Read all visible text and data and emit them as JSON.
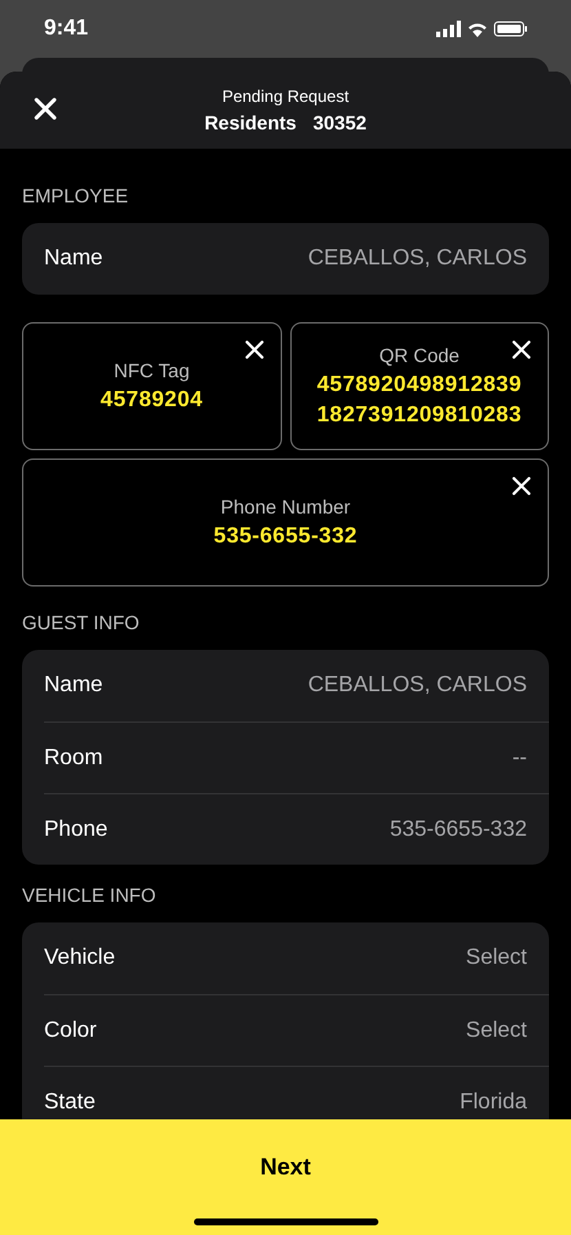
{
  "status_bar": {
    "time": "9:41"
  },
  "header": {
    "subtitle": "Pending Request",
    "title": "Residents",
    "number": "30352"
  },
  "sections": [
    {
      "title": "EMPLOYEE",
      "rows": [
        {
          "label": "Name",
          "value": "CEBALLOS, CARLOS"
        }
      ]
    },
    {
      "kind": "credentials",
      "tiles": [
        {
          "label": "NFC Tag",
          "values": [
            "45789204"
          ],
          "wide": false
        },
        {
          "label": "QR Code",
          "values": [
            "4578920498912839",
            "1827391209810283"
          ],
          "wide": false
        },
        {
          "label": "Phone Number",
          "values": [
            "535-6655-332"
          ],
          "wide": true
        }
      ]
    },
    {
      "title": "GUEST INFO",
      "rows": [
        {
          "label": "Name",
          "value": "CEBALLOS, CARLOS"
        },
        {
          "label": "Room",
          "value": "--"
        },
        {
          "label": "Phone",
          "value": "535-6655-332"
        }
      ]
    },
    {
      "title": "VEHICLE INFO",
      "rows": [
        {
          "label": "Vehicle",
          "value": "Select"
        },
        {
          "label": "Color",
          "value": "Select"
        },
        {
          "label": "State",
          "value": "Florida"
        }
      ]
    }
  ],
  "footer": {
    "button": "Next"
  }
}
